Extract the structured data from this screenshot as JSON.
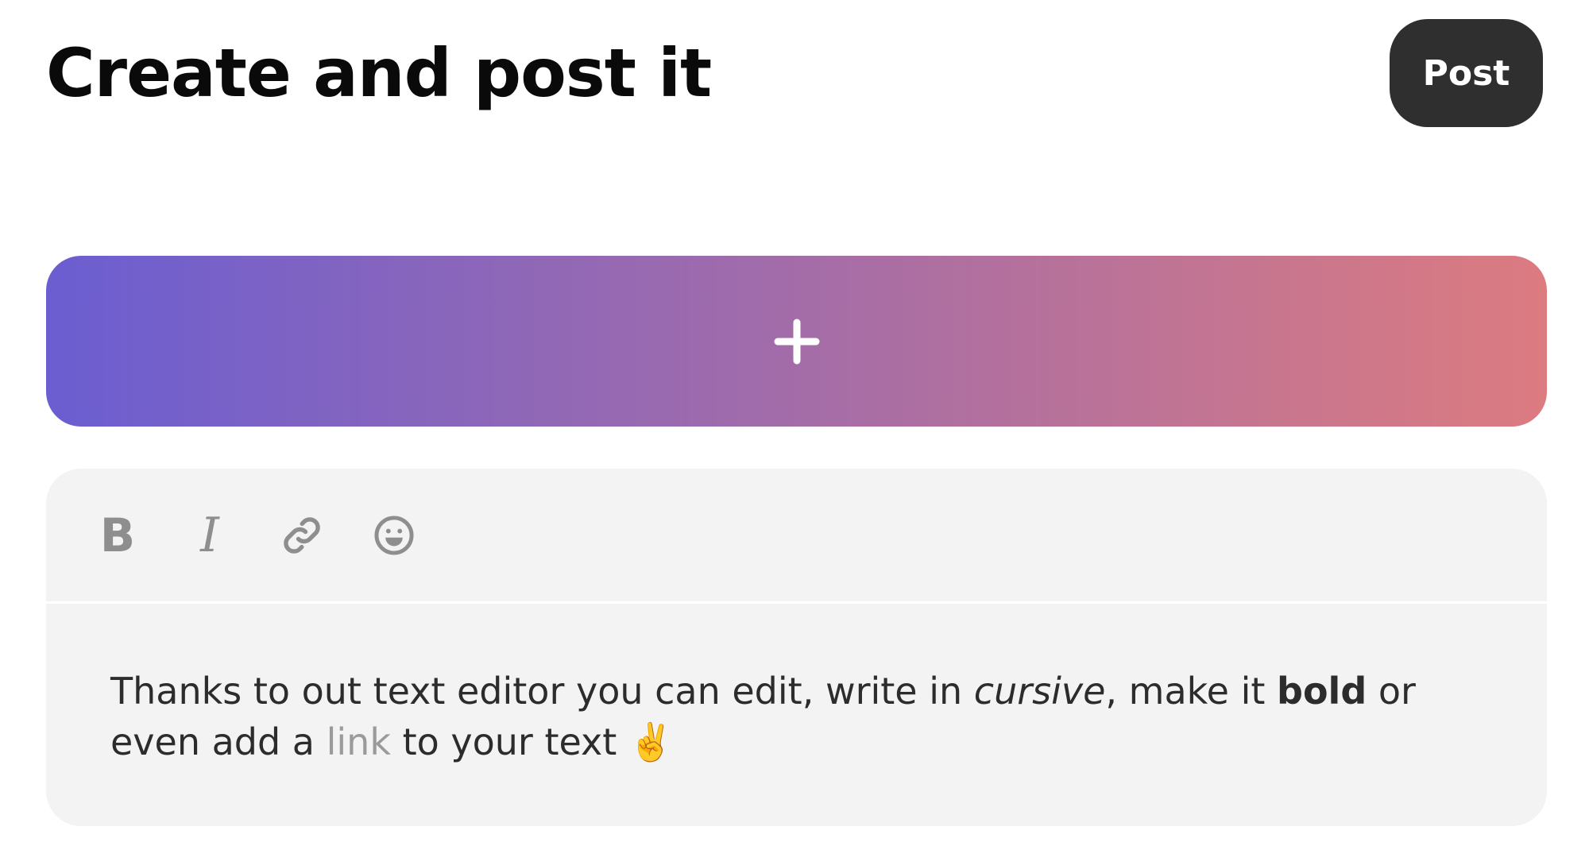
{
  "header": {
    "title": "Create and post it",
    "post_label": "Post"
  },
  "media": {
    "add_icon": "plus-icon",
    "gradient_start": "#6b5ed1",
    "gradient_end": "#dc7b80"
  },
  "toolbar": {
    "bold_glyph": "B",
    "italic_glyph": "I",
    "link_icon": "link-icon",
    "emoji_icon": "emoji-smile-icon",
    "icon_color": "#8e8e8e"
  },
  "editor": {
    "text_part1": "Thanks to out text editor you can edit, write in ",
    "italic_word": "cursive",
    "text_part2": ", make it ",
    "bold_word": "bold",
    "text_part3": " or even add a ",
    "link_word": "link",
    "text_part4": " to your text ",
    "emoji": "✌️",
    "background": "#f3f3f3"
  }
}
